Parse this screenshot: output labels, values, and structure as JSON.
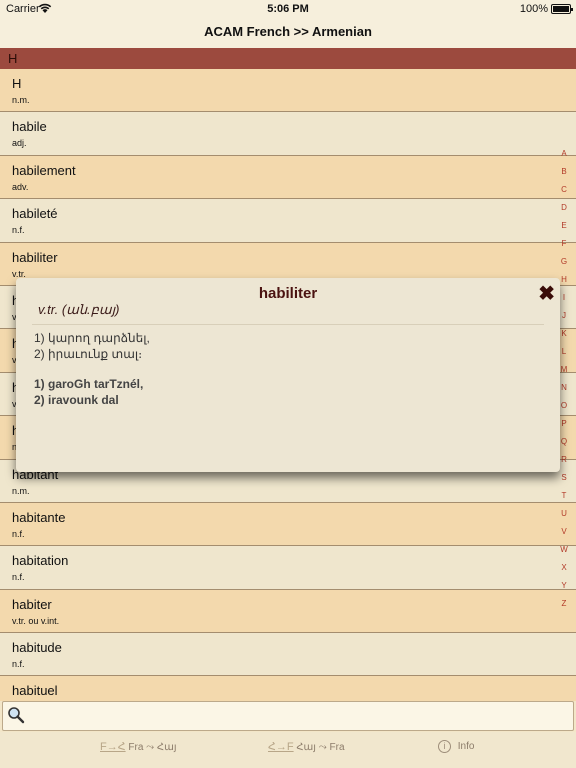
{
  "status": {
    "carrier": "Carrier",
    "time": "5:06 PM",
    "battery": "100%"
  },
  "navbar": {
    "title": "ACAM French >> Armenian"
  },
  "section": {
    "letter": "H"
  },
  "entries": [
    {
      "word": "H",
      "pos": "n.m."
    },
    {
      "word": "habile",
      "pos": "adj."
    },
    {
      "word": "habilement",
      "pos": "adv."
    },
    {
      "word": "habileté",
      "pos": "n.f."
    },
    {
      "word": "habiliter",
      "pos": "v.tr."
    },
    {
      "word": "h",
      "pos": "v"
    },
    {
      "word": "h",
      "pos": "v"
    },
    {
      "word": "h",
      "pos": "v"
    },
    {
      "word": "h",
      "pos": "n"
    },
    {
      "word": "habitant",
      "pos": "n.m."
    },
    {
      "word": "habitante",
      "pos": "n.f."
    },
    {
      "word": "habitation",
      "pos": "n.f."
    },
    {
      "word": "habiter",
      "pos": "v.tr. ou v.int."
    },
    {
      "word": "habitude",
      "pos": "n.f."
    },
    {
      "word": "habituel",
      "pos": ""
    }
  ],
  "index": [
    "A",
    "B",
    "C",
    "D",
    "E",
    "F",
    "G",
    "H",
    "I",
    "J",
    "K",
    "L",
    "M",
    "N",
    "O",
    "P",
    "Q",
    "R",
    "S",
    "T",
    "U",
    "V",
    "W",
    "X",
    "Y",
    "Z"
  ],
  "popup": {
    "title": "habiliter",
    "pos": "v.tr. (ան.բայ)",
    "armenian_1": "1) կարող դարձնել,",
    "armenian_2": "2) իրաւունք տալ։",
    "latin_1": "1) garoGh tarTznél,",
    "latin_2": "2) iravounk dal",
    "close_glyph": "✖"
  },
  "search": {
    "value": "",
    "placeholder": ""
  },
  "tabs": [
    {
      "glyph": "F→Հ",
      "label": "Fra ⤳ Հայ"
    },
    {
      "glyph": "Հ→F",
      "label": "Հայ ⤳ Fra"
    },
    {
      "glyph": "i",
      "label": "Info"
    }
  ]
}
